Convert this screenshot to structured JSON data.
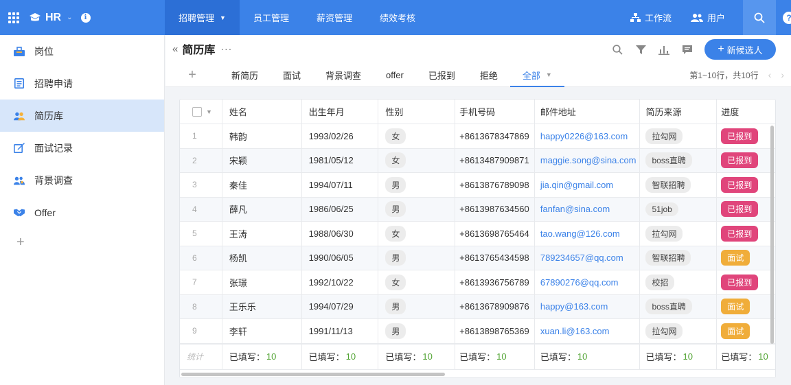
{
  "app": {
    "name": "HR",
    "accent": "#3b82e8",
    "chevron": "⌄",
    "info": "i"
  },
  "topnav": [
    {
      "label": "招聘管理",
      "active": true
    },
    {
      "label": "员工管理"
    },
    {
      "label": "薪资管理"
    },
    {
      "label": "绩效考核"
    }
  ],
  "topright": {
    "workflow": "工作流",
    "users": "用户",
    "help": "?"
  },
  "sidebar": {
    "items": [
      {
        "label": "岗位",
        "icon": "position-icon"
      },
      {
        "label": "招聘申请",
        "icon": "application-icon"
      },
      {
        "label": "简历库",
        "icon": "resume-library-icon",
        "active": true
      },
      {
        "label": "面试记录",
        "icon": "interview-record-icon"
      },
      {
        "label": "背景调查",
        "icon": "background-check-icon"
      },
      {
        "label": "Offer",
        "icon": "offer-icon"
      }
    ],
    "add": "+"
  },
  "header": {
    "collapse": "«",
    "title": "简历库",
    "more": "···",
    "new_button": "新候选人",
    "new_button_plus": "+"
  },
  "tabs": {
    "add": "+",
    "items": [
      "新简历",
      "面试",
      "背景调查",
      "offer",
      "已报到",
      "拒绝",
      "全部"
    ],
    "active_index": 6
  },
  "pager": {
    "text": "第1~10行，共10行",
    "prev": "‹",
    "next": "›"
  },
  "table": {
    "columns": [
      "姓名",
      "出生年月",
      "性别",
      "手机号码",
      "邮件地址",
      "简历来源",
      "进度"
    ],
    "rows": [
      {
        "idx": "1",
        "name": "韩韵",
        "birth": "1993/02/26",
        "sex": "女",
        "phone": "+8613678347869",
        "email": "happy0226@163.com",
        "source": "拉勾网",
        "status": "已报到",
        "status_color": "#e0457b"
      },
      {
        "idx": "2",
        "name": "宋颖",
        "birth": "1981/05/12",
        "sex": "女",
        "phone": "+8613487909871",
        "email": "maggie.song@sina.com",
        "source": "boss直聘",
        "status": "已报到",
        "status_color": "#e0457b"
      },
      {
        "idx": "3",
        "name": "秦佳",
        "birth": "1994/07/11",
        "sex": "男",
        "phone": "+8613876789098",
        "email": "jia.qin@gmail.com",
        "source": "智联招聘",
        "status": "已报到",
        "status_color": "#e0457b"
      },
      {
        "idx": "4",
        "name": "薛凡",
        "birth": "1986/06/25",
        "sex": "男",
        "phone": "+8613987634560",
        "email": "fanfan@sina.com",
        "source": "51job",
        "status": "已报到",
        "status_color": "#e0457b"
      },
      {
        "idx": "5",
        "name": "王涛",
        "birth": "1988/06/30",
        "sex": "女",
        "phone": "+8613698765464",
        "email": "tao.wang@126.com",
        "source": "拉勾网",
        "status": "已报到",
        "status_color": "#e0457b"
      },
      {
        "idx": "6",
        "name": "杨凯",
        "birth": "1990/06/05",
        "sex": "男",
        "phone": "+8613765434598",
        "email": "789234657@qq.com",
        "source": "智联招聘",
        "status": "面试",
        "status_color": "#f0ad3a"
      },
      {
        "idx": "7",
        "name": "张璟",
        "birth": "1992/10/22",
        "sex": "女",
        "phone": "+8613936756789",
        "email": "67890276@qq.com",
        "source": "校招",
        "status": "已报到",
        "status_color": "#e0457b"
      },
      {
        "idx": "8",
        "name": "王乐乐",
        "birth": "1994/07/29",
        "sex": "男",
        "phone": "+8613678909876",
        "email": "happy@163.com",
        "source": "boss直聘",
        "status": "面试",
        "status_color": "#f0ad3a"
      },
      {
        "idx": "9",
        "name": "李轩",
        "birth": "1991/11/13",
        "sex": "男",
        "phone": "+8613898765369",
        "email": "xuan.li@163.com",
        "source": "拉勾网",
        "status": "面试",
        "status_color": "#f0ad3a"
      }
    ],
    "footer": {
      "label": "统计",
      "filled_label": "已填写：",
      "filled_count": "10"
    }
  }
}
